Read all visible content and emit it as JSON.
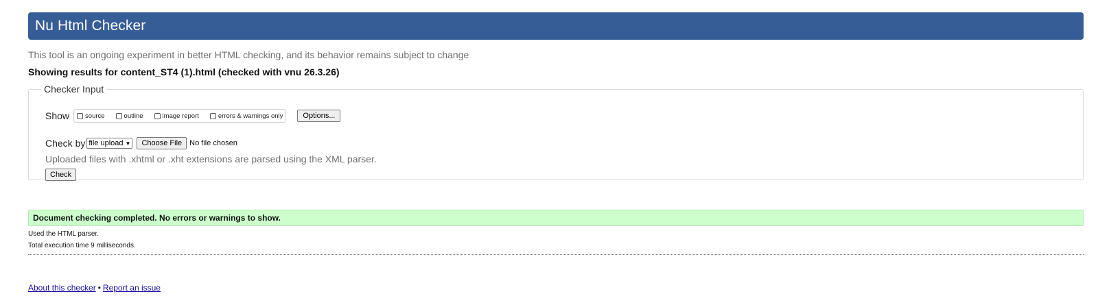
{
  "header": {
    "title": "Nu Html Checker",
    "subtitle": "This tool is an ongoing experiment in better HTML checking, and its behavior remains subject to change",
    "results_heading": "Showing results for content_ST4 (1).html (checked with vnu 26.3.26)"
  },
  "checker_input": {
    "legend": "Checker Input",
    "show_label": "Show",
    "show_options": [
      {
        "label": "source",
        "checked": false
      },
      {
        "label": "outline",
        "checked": false
      },
      {
        "label": "image report",
        "checked": false
      },
      {
        "label": "errors & warnings only",
        "checked": false
      }
    ],
    "options_button": "Options...",
    "check_by_label": "Check by",
    "check_by_selected": "file upload",
    "choose_file_button": "Choose File",
    "no_file_text": "No file chosen",
    "xml_note": "Uploaded files with .xhtml or .xht extensions are parsed using the XML parser.",
    "check_button": "Check"
  },
  "result": {
    "message": "Document checking completed. No errors or warnings to show.",
    "parser_info": "Used the HTML parser.",
    "execution_time": "Total execution time 9 milliseconds."
  },
  "footer": {
    "about_link": "About this checker",
    "separator": "•",
    "report_link": "Report an issue"
  },
  "colors": {
    "header_bg": "#365d96",
    "success_bg": "#ccffcc",
    "link": "#1a0dab"
  }
}
